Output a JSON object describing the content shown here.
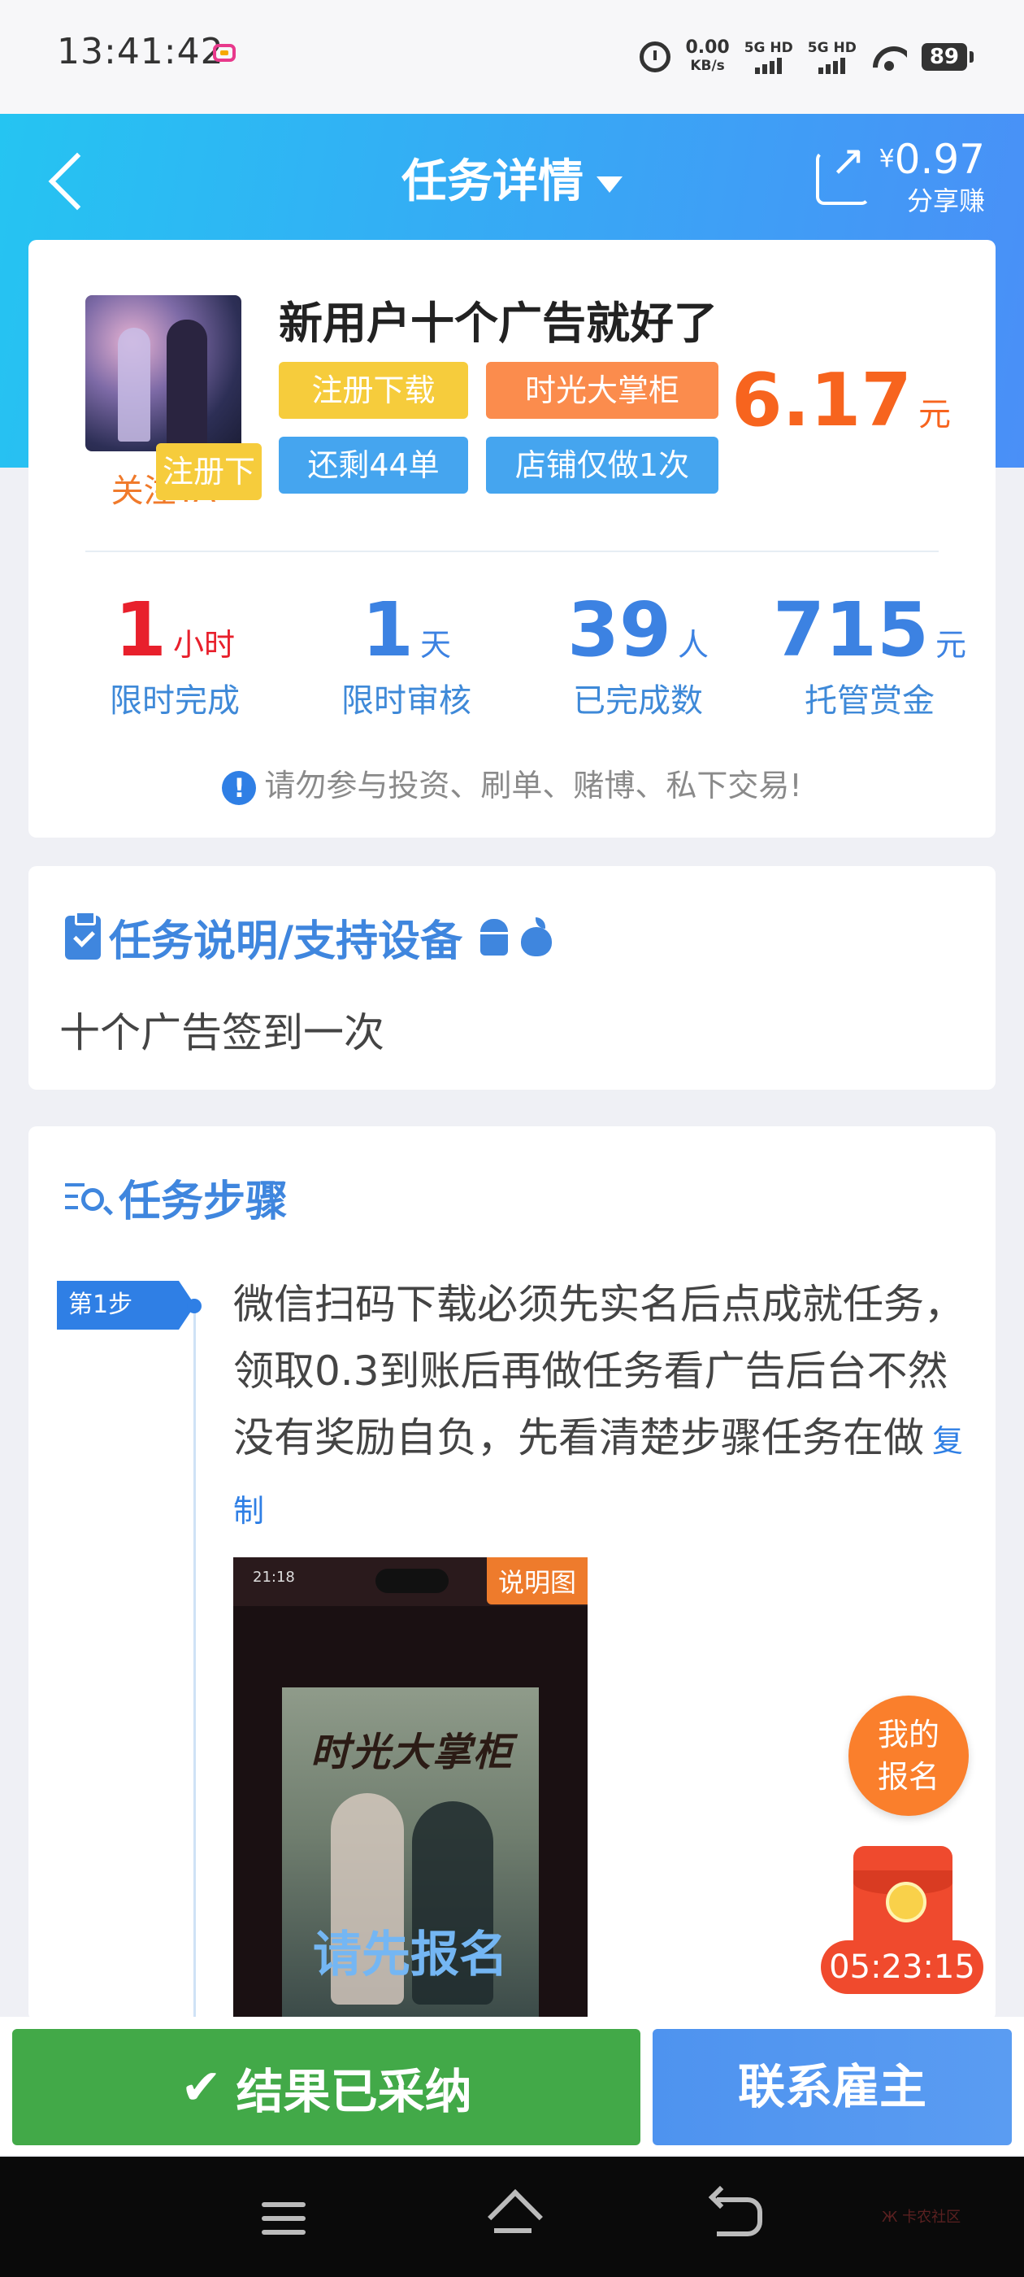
{
  "status_bar": {
    "time": "13:41:42",
    "net_speed_value": "0.00",
    "net_speed_unit": "KB/s",
    "signal1": "5G HD",
    "signal2": "5G HD",
    "battery": "89"
  },
  "header": {
    "title": "任务详情",
    "share_amount": "0.97",
    "share_currency": "¥",
    "share_label": "分享赚"
  },
  "task": {
    "avatar_action": "关注TA",
    "title": "新用户十个广告就好了",
    "tags": [
      "注册下载",
      "时光大掌柜",
      "还剩44单",
      "店铺仅做1次"
    ],
    "price": "6.17",
    "price_unit": "元",
    "stats": [
      {
        "value": "1",
        "unit": "小时",
        "label": "限时完成"
      },
      {
        "value": "1",
        "unit": "天",
        "label": "限时审核"
      },
      {
        "value": "39",
        "unit": "人",
        "label": "已完成数"
      },
      {
        "value": "715",
        "unit": "元",
        "label": "托管赏金"
      }
    ],
    "warning_icon": "!",
    "warning": "请勿参与投资、刷单、赌博、私下交易!"
  },
  "description": {
    "title": "任务说明/支持设备",
    "text": "十个广告签到一次"
  },
  "steps": {
    "title": "任务步骤",
    "items": [
      {
        "badge": "第1步",
        "text": "微信扫码下载必须先实名后点成就任务，领取0.3到账后再做任务看广告后台不然没有奖励自负，先看清楚步骤任务在做",
        "copy_label": "复制",
        "image_label": "说明图",
        "image_time": "21:18",
        "image_logo": "时光大掌柜",
        "image_overlay": "请先报名"
      }
    ]
  },
  "floating": {
    "signup_line1": "我的",
    "signup_line2": "报名",
    "timer": "05:23:15"
  },
  "actions": {
    "accepted_check": "✔",
    "accepted": "结果已采纳",
    "contact": "联系雇主"
  },
  "watermark": "Ж 卡农社区"
}
